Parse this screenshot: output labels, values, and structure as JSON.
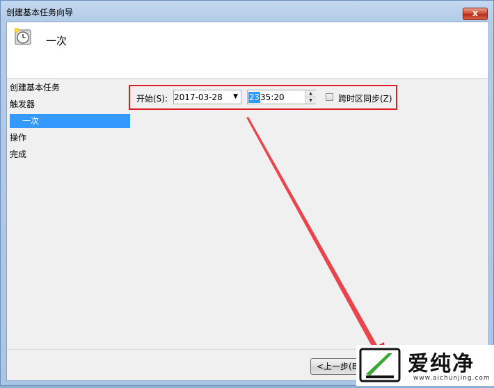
{
  "window": {
    "title": "创建基本任务向导",
    "close_glyph": "x"
  },
  "header": {
    "title": "一次",
    "icon": "clock-icon"
  },
  "steps": {
    "create": "创建基本任务",
    "trigger": "触发器",
    "once": "一次",
    "action": "操作",
    "finish": "完成"
  },
  "form": {
    "start_label": "开始(S):",
    "date_value": "2017-03-28",
    "time_hour": "23",
    "time_rest": ":35:20",
    "timezone_sync_label": "跨时区同步(Z)",
    "timezone_sync_checked": false
  },
  "footer": {
    "back_label": "<上一步(B"
  },
  "watermark": {
    "text": "爱纯净",
    "url": "www.aichunjing.com"
  },
  "colors": {
    "highlight": "#e01b24",
    "selection": "#3399ff",
    "arrow": "#e8323a"
  }
}
